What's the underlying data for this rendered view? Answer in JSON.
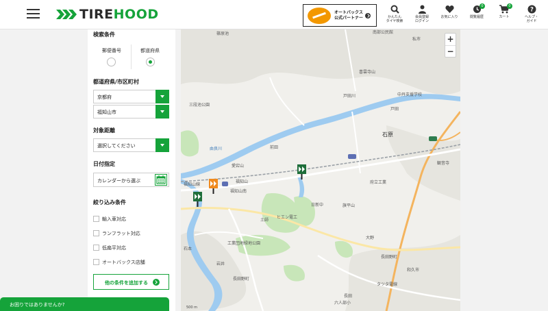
{
  "header": {
    "logo_brand": "TIREHOOD",
    "partner": {
      "line1": "オートバックス",
      "line2": "公式パートナー",
      "logo_text": "AUTOBACS"
    },
    "nav": [
      {
        "icon": "search-icon",
        "line1": "かんたん",
        "line2": "タイヤ検索"
      },
      {
        "icon": "person-icon",
        "line1": "会員登録",
        "line2": "ログイン"
      },
      {
        "icon": "heart-icon",
        "line1": "お気に入り",
        "line2": ""
      },
      {
        "icon": "history-icon",
        "line1": "閲覧履歴",
        "line2": "",
        "badge": "0"
      },
      {
        "icon": "cart-icon",
        "line1": "カート",
        "line2": "",
        "badge": "0"
      },
      {
        "icon": "help-icon",
        "line1": "ヘルプ・",
        "line2": "ガイド"
      }
    ]
  },
  "sidebar": {
    "search_conditions_title": "検索条件",
    "radio_postal": "郵便番号",
    "radio_prefecture": "都道府県",
    "selected_radio": "prefecture",
    "location_title": "都道府県/市区町村",
    "prefecture_value": "京都府",
    "city_value": "福知山市",
    "distance_title": "対象距離",
    "distance_value": "選択してください",
    "date_title": "日付指定",
    "date_value": "カレンダーから選ぶ",
    "filter_title": "絞り込み条件",
    "filters": [
      "輸入車対応",
      "ランフラット対応",
      "低扁平対応",
      "オートバックス店舗"
    ],
    "add_button": "他の条件を追加する"
  },
  "help_bar": "お困りではありませんか?",
  "map": {
    "zoom_in": "+",
    "zoom_out": "−",
    "scale": "500 m",
    "labels": [
      "篠原池",
      "南部公民館",
      "私市",
      "喜雲寺山",
      "中丹支援学校",
      "戸田川",
      "戸田",
      "三段池公園",
      "石原",
      "由良川",
      "前田",
      "観音寺",
      "愛宕山",
      "府立工業",
      "福知山",
      "旗平山",
      "福知山南",
      "日新中",
      "土師",
      "ヒエン電工",
      "工業団地緑地公園",
      "大野",
      "長田野町",
      "岩井",
      "長田野町",
      "長田",
      "タツタ電線",
      "六人部小",
      "石本",
      "和久市",
      "福知山線"
    ]
  },
  "colors": {
    "brand_green": "#15a33a",
    "map_water": "#9ecbf0",
    "map_park": "#c8e6b9",
    "map_highway": "#f4b45e",
    "pin_green": "#1e6e3a",
    "pin_orange": "#f08a1e"
  }
}
